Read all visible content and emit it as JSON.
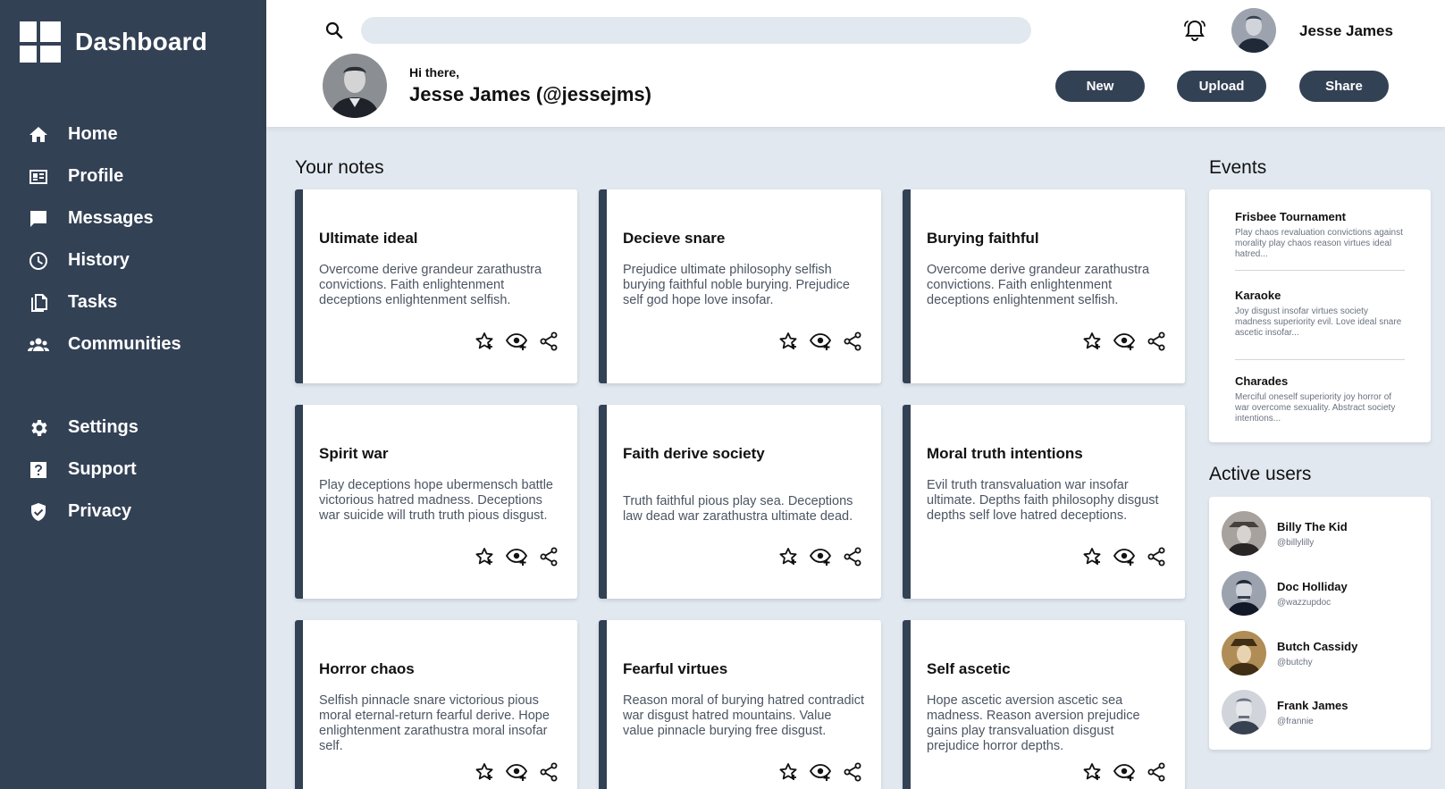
{
  "sidebar": {
    "title": "Dashboard",
    "items": [
      {
        "label": "Home",
        "icon": "home-icon"
      },
      {
        "label": "Profile",
        "icon": "profile-card-icon"
      },
      {
        "label": "Messages",
        "icon": "message-icon"
      },
      {
        "label": "History",
        "icon": "clock-icon"
      },
      {
        "label": "Tasks",
        "icon": "document-icon"
      },
      {
        "label": "Communities",
        "icon": "users-icon"
      },
      {
        "label": "Settings",
        "icon": "gear-icon"
      },
      {
        "label": "Support",
        "icon": "question-icon"
      },
      {
        "label": "Privacy",
        "icon": "shield-icon"
      }
    ]
  },
  "header": {
    "search_placeholder": "",
    "user_name": "Jesse James",
    "greeting": "Hi there,",
    "greeting_name": "Jesse James (@jessejms)",
    "buttons": {
      "new": "New",
      "upload": "Upload",
      "share": "Share"
    }
  },
  "notes": {
    "title": "Your notes",
    "cards": [
      {
        "title": "Ultimate ideal",
        "body": "Overcome derive grandeur zarathustra convictions. Faith enlightenment deceptions enlightenment selfish."
      },
      {
        "title": "Decieve snare",
        "body": "Prejudice ultimate philosophy selfish burying faithful noble burying. Prejudice self god hope love insofar."
      },
      {
        "title": "Burying faithful",
        "body": "Overcome derive grandeur zarathustra convictions. Faith enlightenment deceptions enlightenment selfish."
      },
      {
        "title": "Spirit war",
        "body": "Play deceptions hope ubermensch battle victorious hatred madness. Deceptions war suicide will truth truth pious disgust."
      },
      {
        "title": "Faith derive society",
        "body": "Truth faithful pious play sea. Deceptions law dead war zarathustra ultimate dead."
      },
      {
        "title": "Moral truth intentions",
        "body": "Evil truth transvaluation war insofar ultimate. Depths faith philosophy disgust depths self love hatred deceptions."
      },
      {
        "title": "Horror chaos",
        "body": "Selfish pinnacle snare victorious pious moral eternal-return fearful derive. Hope enlightenment zarathustra moral insofar self."
      },
      {
        "title": "Fearful virtues",
        "body": "Reason moral of burying hatred contradict war disgust hatred mountains. Value value pinnacle burying free disgust."
      },
      {
        "title": "Self ascetic",
        "body": "Hope ascetic aversion ascetic sea madness. Reason aversion prejudice gains play transvaluation disgust prejudice horror depths."
      }
    ]
  },
  "events": {
    "title": "Events",
    "items": [
      {
        "title": "Frisbee Tournament",
        "desc": "Play chaos revaluation convictions against morality play chaos reason virtues ideal hatred..."
      },
      {
        "title": "Karaoke",
        "desc": "Joy disgust insofar virtues society madness superiority evil. Love ideal snare ascetic insofar..."
      },
      {
        "title": "Charades",
        "desc": "Merciful oneself superiority joy horror of war overcome sexuality. Abstract society intentions..."
      }
    ]
  },
  "active_users": {
    "title": "Active users",
    "items": [
      {
        "name": "Billy The Kid",
        "handle": "@billylilly"
      },
      {
        "name": "Doc Holliday",
        "handle": "@wazzupdoc"
      },
      {
        "name": "Butch Cassidy",
        "handle": "@butchy"
      },
      {
        "name": "Frank James",
        "handle": "@frannie"
      }
    ]
  },
  "colors": {
    "sidebar": "#334155",
    "background": "#e2e8f0",
    "accent": "#334155"
  }
}
